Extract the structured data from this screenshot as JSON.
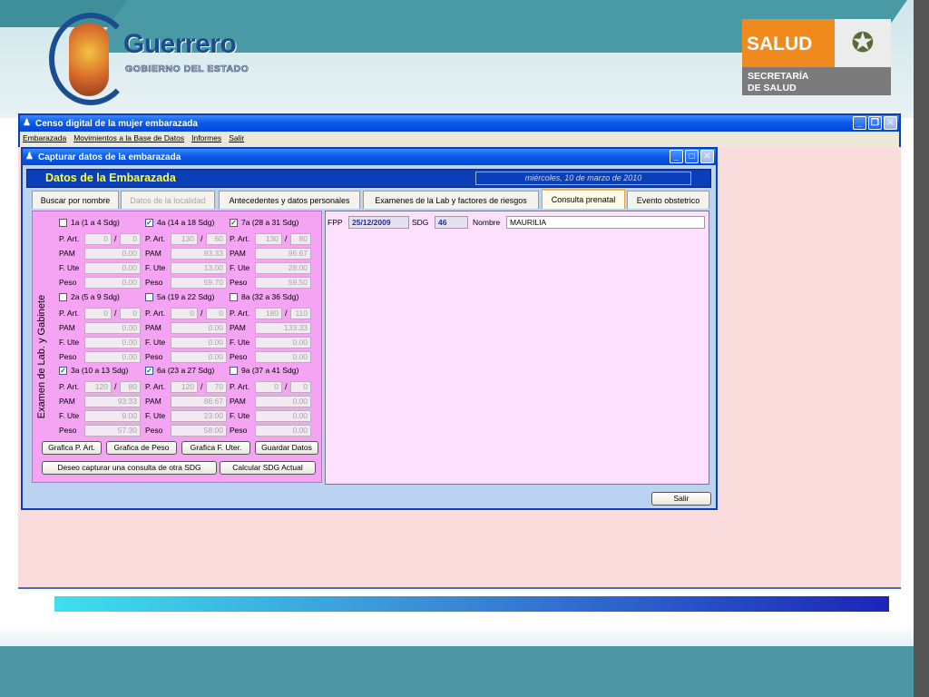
{
  "slide": {
    "guerrero_title": "Guerrero",
    "guerrero_sub": "GOBIERNO DEL ESTADO",
    "salud_word": "SALUD",
    "salud_secretaria": "SECRETARÍA\nDE SALUD"
  },
  "main_window": {
    "title": "Censo digital de la mujer embarazada",
    "menu": [
      "Embarazada",
      "Movimientos a la Base de Datos",
      "Informes",
      "Salir"
    ]
  },
  "dialog": {
    "title": "Capturar datos de la embarazada",
    "header_title": "Datos de la Embarazada",
    "date": "miércoles, 10 de marzo de 2010",
    "tabs": [
      {
        "label": "Buscar por nombre"
      },
      {
        "label": "Datos de la localidad"
      },
      {
        "label": "Antecedentes y datos personales"
      },
      {
        "label": "Examenes de la Lab y factores de riesgos"
      },
      {
        "label": "Consulta prenatal"
      },
      {
        "label": "Evento obstetrico"
      }
    ],
    "vertical_label": "Examen de Lab. y Gabinete",
    "field_labels": {
      "part": "P. Art.",
      "pam": "PAM",
      "fute": "F. Ute",
      "peso": "Peso",
      "slash": "/"
    },
    "exams": [
      {
        "title": "1a (1 a 4 Sdg)",
        "checked": false,
        "p1": "0",
        "p2": "0",
        "pam": "0.00",
        "fute": "0.00",
        "peso": "0.00"
      },
      {
        "title": "4a (14 a 18 Sdg)",
        "checked": true,
        "p1": "130",
        "p2": "60",
        "pam": "83.33",
        "fute": "13.00",
        "peso": "59.70"
      },
      {
        "title": "7a (28 a 31 Sdg)",
        "checked": true,
        "p1": "130",
        "p2": "80",
        "pam": "96.67",
        "fute": "28.00",
        "peso": "59.50"
      },
      {
        "title": "2a (5 a 9 Sdg)",
        "checked": false,
        "p1": "0",
        "p2": "0",
        "pam": "0.00",
        "fute": "0.00",
        "peso": "0.00"
      },
      {
        "title": "5a (19 a 22 Sdg)",
        "checked": false,
        "p1": "0",
        "p2": "0",
        "pam": "0.00",
        "fute": "0.00",
        "peso": "0.00"
      },
      {
        "title": "8a (32 a 36 Sdg)",
        "checked": false,
        "p1": "180",
        "p2": "110",
        "pam": "133.33",
        "fute": "0.00",
        "peso": "0.00"
      },
      {
        "title": "3a (10 a 13 Sdg)",
        "checked": true,
        "p1": "120",
        "p2": "80",
        "pam": "93.33",
        "fute": "9.00",
        "peso": "57.30"
      },
      {
        "title": "6a (23 a 27 Sdg)",
        "checked": true,
        "p1": "120",
        "p2": "70",
        "pam": "86.67",
        "fute": "23.00",
        "peso": "58.00"
      },
      {
        "title": "9a (37 a 41 Sdg)",
        "checked": false,
        "p1": "0",
        "p2": "0",
        "pam": "0.00",
        "fute": "0.00",
        "peso": "0.00"
      }
    ],
    "buttons": {
      "grafica_part": "Grafica P. Art.",
      "grafica_peso": "Grafica de Peso",
      "grafica_fute": "Grafica F. Uter.",
      "guardar": "Guardar Datos",
      "otra_sdg": "Deseo capturar una consulta de otra SDG",
      "calcular": "Calcular SDG Actual",
      "salir": "Salir"
    },
    "consulta": {
      "fpp_label": "FPP",
      "fpp_value": "25/12/2009",
      "sdg_label": "SDG",
      "sdg_value": "46",
      "nombre_label": "Nombre",
      "nombre_value": "MAURILIA"
    }
  }
}
